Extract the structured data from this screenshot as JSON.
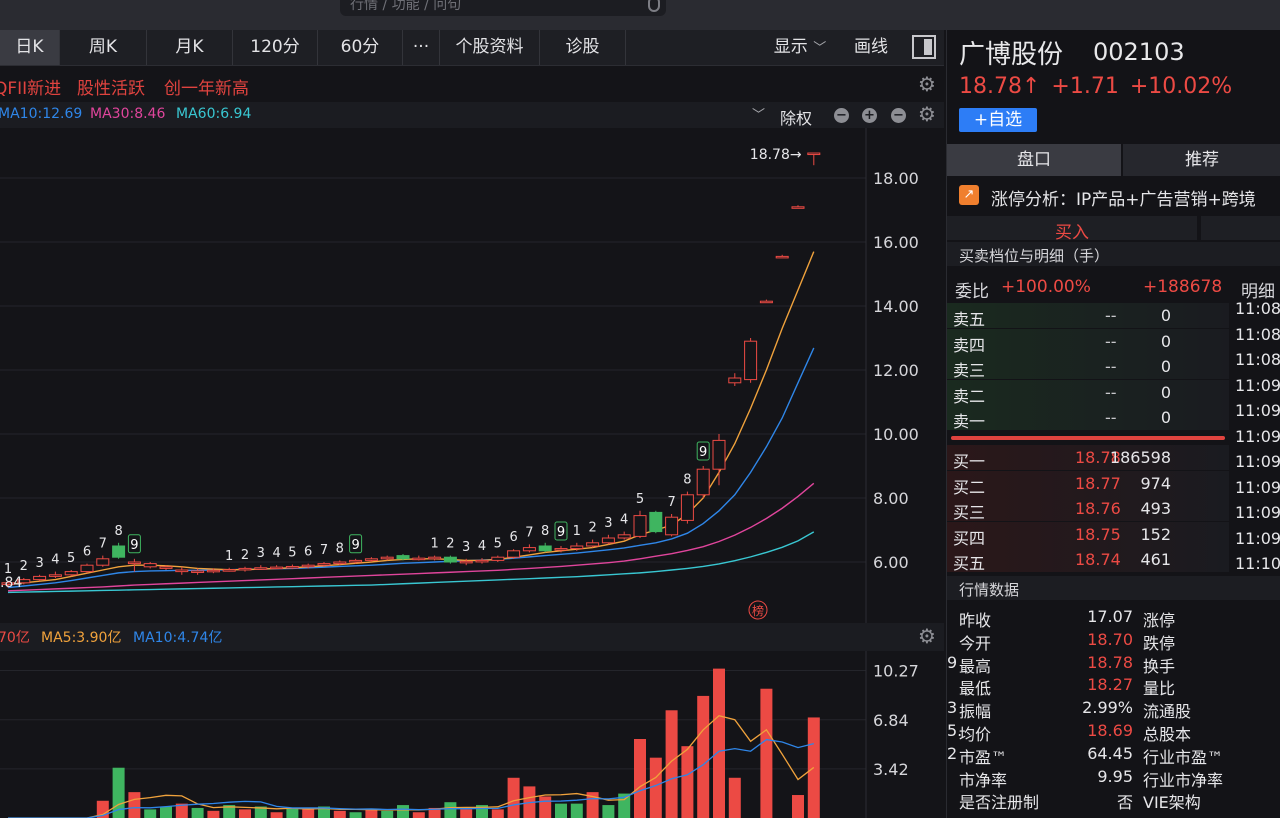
{
  "search": {
    "placeholder": "行情 / 功能 / 问句"
  },
  "toolbar": {
    "tabs": [
      "日K",
      "周K",
      "月K",
      "120分",
      "60分",
      "···",
      "个股资料",
      "诊股"
    ],
    "show": "显示",
    "draw": "画线"
  },
  "tags": [
    "QFII新进",
    "股性活跃",
    "创一年新高"
  ],
  "ma": {
    "ma10": "MA10:12.69",
    "ma30": "MA30:8.46",
    "ma60": "MA60:6.94",
    "adjust": "除权"
  },
  "vol_header": {
    "vol": "70亿",
    "ma5": "MA5:3.90亿",
    "ma10": "MA10:4.74亿"
  },
  "bang": "榜",
  "colors": {
    "up": "#ec4a44",
    "down": "#3fb560",
    "ma5": "#f0a23c",
    "ma10": "#2f86e8",
    "ma30": "#e0459c",
    "ma60": "#39c7d2",
    "bg": "#141418"
  },
  "chart_data": {
    "type": "candlestick",
    "ylim": [
      5.0,
      19.0
    ],
    "ticks": [
      "18.00",
      "16.00",
      "14.00",
      "12.00",
      "10.00",
      "8.00",
      "6.00"
    ],
    "tick_values": [
      18,
      16,
      14,
      12,
      10,
      8,
      6
    ],
    "low_label": ".84",
    "low_value": 5.84,
    "last_label": "18.78",
    "last_value": 18.78,
    "candles": [
      [
        5.3,
        5.35,
        5.2,
        5.4
      ],
      [
        5.35,
        5.45,
        5.3,
        5.5
      ],
      [
        5.45,
        5.55,
        5.4,
        5.6
      ],
      [
        5.55,
        5.6,
        5.5,
        5.7
      ],
      [
        5.6,
        5.7,
        5.55,
        5.75
      ],
      [
        5.7,
        5.9,
        5.65,
        5.95
      ],
      [
        5.9,
        6.1,
        5.85,
        6.2
      ],
      [
        6.5,
        6.15,
        6.1,
        6.6
      ],
      [
        5.95,
        6.0,
        5.7,
        6.1
      ],
      [
        5.85,
        5.95,
        5.8,
        6.0
      ],
      [
        5.8,
        5.85,
        5.75,
        5.9
      ],
      [
        5.7,
        5.75,
        5.6,
        5.85
      ],
      [
        5.7,
        5.72,
        5.6,
        5.8
      ],
      [
        5.72,
        5.74,
        5.65,
        5.8
      ],
      [
        5.74,
        5.76,
        5.7,
        5.82
      ],
      [
        5.76,
        5.8,
        5.7,
        5.85
      ],
      [
        5.8,
        5.82,
        5.75,
        5.9
      ],
      [
        5.82,
        5.84,
        5.78,
        5.9
      ],
      [
        5.84,
        5.86,
        5.78,
        5.92
      ],
      [
        5.86,
        5.9,
        5.8,
        5.95
      ],
      [
        5.9,
        5.95,
        5.85,
        6.0
      ],
      [
        5.95,
        6.0,
        5.9,
        6.05
      ],
      [
        6.0,
        6.05,
        5.95,
        6.1
      ],
      [
        6.05,
        6.1,
        6.0,
        6.15
      ],
      [
        6.1,
        6.15,
        6.05,
        6.2
      ],
      [
        6.2,
        6.1,
        6.05,
        6.25
      ],
      [
        6.1,
        6.12,
        6.05,
        6.2
      ],
      [
        6.1,
        6.15,
        6.05,
        6.2
      ],
      [
        6.15,
        6.0,
        5.95,
        6.2
      ],
      [
        6.0,
        6.02,
        5.9,
        6.1
      ],
      [
        6.02,
        6.05,
        5.95,
        6.12
      ],
      [
        6.05,
        6.15,
        6.0,
        6.2
      ],
      [
        6.15,
        6.35,
        6.1,
        6.4
      ],
      [
        6.35,
        6.45,
        6.3,
        6.55
      ],
      [
        6.5,
        6.35,
        6.3,
        6.6
      ],
      [
        6.4,
        6.42,
        6.3,
        6.5
      ],
      [
        6.42,
        6.5,
        6.35,
        6.6
      ],
      [
        6.5,
        6.6,
        6.45,
        6.7
      ],
      [
        6.6,
        6.75,
        6.55,
        6.85
      ],
      [
        6.75,
        6.85,
        6.7,
        6.95
      ],
      [
        6.8,
        7.45,
        6.75,
        7.6
      ],
      [
        7.55,
        6.95,
        6.9,
        7.6
      ],
      [
        6.85,
        7.4,
        6.8,
        7.5
      ],
      [
        7.3,
        8.1,
        7.2,
        8.2
      ],
      [
        8.1,
        8.9,
        8.0,
        9.0
      ],
      [
        8.9,
        9.8,
        8.4,
        10.0
      ],
      [
        11.6,
        11.75,
        11.5,
        11.9
      ],
      [
        11.7,
        12.9,
        11.6,
        13.0
      ],
      [
        14.15,
        14.15,
        14.15,
        14.2
      ],
      [
        15.55,
        15.55,
        15.55,
        15.6
      ],
      [
        17.1,
        17.1,
        17.1,
        17.15
      ],
      [
        18.78,
        18.78,
        18.4,
        18.78
      ]
    ],
    "counts": [
      "1",
      "2",
      "3",
      "4",
      "5",
      "6",
      "7",
      "8",
      "9",
      "",
      "",
      "",
      "",
      "",
      "1",
      "2",
      "3",
      "4",
      "5",
      "6",
      "7",
      "8",
      "9",
      "",
      "",
      "",
      "",
      "1",
      "2",
      "3",
      "4",
      "5",
      "6",
      "7",
      "8",
      "9",
      "1",
      "2",
      "3",
      "4",
      "5",
      "",
      "7",
      "8",
      "9",
      "",
      "",
      "",
      "",
      "",
      "",
      ""
    ],
    "ma10_line": [
      5.2,
      5.25,
      5.3,
      5.35,
      5.42,
      5.5,
      5.58,
      5.66,
      5.7,
      5.72,
      5.73,
      5.74,
      5.74,
      5.75,
      5.76,
      5.77,
      5.78,
      5.79,
      5.8,
      5.82,
      5.84,
      5.86,
      5.88,
      5.9,
      5.93,
      5.96,
      5.98,
      6.0,
      6.02,
      6.04,
      6.06,
      6.08,
      6.12,
      6.16,
      6.2,
      6.24,
      6.28,
      6.33,
      6.38,
      6.44,
      6.52,
      6.6,
      6.72,
      6.9,
      7.2,
      7.6,
      8.1,
      8.8,
      9.6,
      10.5,
      11.6,
      12.69
    ],
    "ma5_line": [
      5.3,
      5.35,
      5.4,
      5.45,
      5.55,
      5.65,
      5.75,
      5.85,
      5.9,
      5.9,
      5.88,
      5.85,
      5.8,
      5.78,
      5.76,
      5.76,
      5.78,
      5.8,
      5.82,
      5.85,
      5.88,
      5.92,
      5.96,
      6.0,
      6.05,
      6.08,
      6.1,
      6.1,
      6.08,
      6.05,
      6.05,
      6.08,
      6.15,
      6.22,
      6.3,
      6.35,
      6.4,
      6.45,
      6.55,
      6.65,
      6.85,
      7.0,
      7.15,
      7.5,
      8.0,
      8.8,
      9.7,
      10.8,
      12.0,
      13.3,
      14.5,
      15.7
    ],
    "ma30_line": [
      5.1,
      5.12,
      5.14,
      5.16,
      5.18,
      5.2,
      5.22,
      5.25,
      5.28,
      5.3,
      5.32,
      5.34,
      5.36,
      5.38,
      5.4,
      5.42,
      5.44,
      5.46,
      5.48,
      5.5,
      5.52,
      5.54,
      5.56,
      5.58,
      5.6,
      5.62,
      5.64,
      5.66,
      5.68,
      5.7,
      5.72,
      5.74,
      5.77,
      5.8,
      5.83,
      5.86,
      5.9,
      5.94,
      5.98,
      6.03,
      6.1,
      6.18,
      6.26,
      6.36,
      6.48,
      6.64,
      6.84,
      7.08,
      7.36,
      7.68,
      8.05,
      8.46
    ],
    "ma60_line": [
      5.05,
      5.06,
      5.07,
      5.08,
      5.09,
      5.1,
      5.11,
      5.12,
      5.13,
      5.14,
      5.15,
      5.16,
      5.17,
      5.18,
      5.19,
      5.2,
      5.21,
      5.22,
      5.23,
      5.24,
      5.25,
      5.26,
      5.27,
      5.28,
      5.3,
      5.32,
      5.34,
      5.36,
      5.38,
      5.4,
      5.42,
      5.44,
      5.46,
      5.48,
      5.5,
      5.52,
      5.54,
      5.57,
      5.6,
      5.63,
      5.66,
      5.7,
      5.75,
      5.8,
      5.86,
      5.94,
      6.04,
      6.16,
      6.3,
      6.46,
      6.66,
      6.94
    ],
    "vol_ticks": [
      "10.27",
      "6.84",
      "3.42"
    ],
    "vol_tick_values": [
      10.27,
      6.84,
      3.42
    ],
    "vol_max": 11.0,
    "volumes": [
      [
        0,
        0
      ],
      [
        0,
        0
      ],
      [
        0,
        0
      ],
      [
        0,
        0
      ],
      [
        0,
        0
      ],
      [
        0,
        0
      ],
      [
        1.2,
        1
      ],
      [
        3.5,
        0
      ],
      [
        1.8,
        1
      ],
      [
        0.6,
        0
      ],
      [
        0.8,
        0
      ],
      [
        1.0,
        1
      ],
      [
        0.7,
        0
      ],
      [
        0.5,
        1
      ],
      [
        0.9,
        0
      ],
      [
        0.6,
        1
      ],
      [
        0.8,
        0
      ],
      [
        0.4,
        1
      ],
      [
        0.7,
        0
      ],
      [
        0.6,
        1
      ],
      [
        0.8,
        0
      ],
      [
        0.5,
        1
      ],
      [
        0.4,
        0
      ],
      [
        0.6,
        1
      ],
      [
        0.5,
        0
      ],
      [
        0.9,
        0
      ],
      [
        0.4,
        1
      ],
      [
        0.7,
        1
      ],
      [
        1.1,
        0
      ],
      [
        0.6,
        1
      ],
      [
        0.9,
        0
      ],
      [
        0.6,
        1
      ],
      [
        2.8,
        1
      ],
      [
        2.2,
        1
      ],
      [
        1.5,
        1
      ],
      [
        1.0,
        0
      ],
      [
        1.0,
        0
      ],
      [
        1.8,
        1
      ],
      [
        0.9,
        0
      ],
      [
        1.7,
        0
      ],
      [
        5.5,
        1
      ],
      [
        4.2,
        1
      ],
      [
        7.5,
        1
      ],
      [
        5.0,
        1
      ],
      [
        8.5,
        1
      ],
      [
        10.4,
        1
      ],
      [
        2.8,
        1
      ],
      [
        0,
        0
      ],
      [
        9.0,
        1
      ],
      [
        0,
        0
      ],
      [
        1.6,
        1
      ],
      [
        7.0,
        1
      ]
    ]
  },
  "stock": {
    "name": "广博股份",
    "code": "002103",
    "price": "18.78↑",
    "change": "+1.71",
    "pct": "+10.02%",
    "fav": "+自选"
  },
  "tabs": [
    "盘口",
    "推荐"
  ],
  "zt": {
    "icon": "↗",
    "text": "涨停分析：IP产品+广告营销+跨境"
  },
  "buy_label": "买入",
  "order_header": "买卖档位与明细（手）",
  "weibi": {
    "label": "委比",
    "pct": "+100.00%",
    "diff": "+188678",
    "mx": "明细"
  },
  "sells": [
    [
      "卖五",
      "--",
      "0"
    ],
    [
      "卖四",
      "--",
      "0"
    ],
    [
      "卖三",
      "--",
      "0"
    ],
    [
      "卖二",
      "--",
      "0"
    ],
    [
      "卖一",
      "--",
      "0"
    ]
  ],
  "buys": [
    [
      "买一",
      "18.78",
      "186598"
    ],
    [
      "买二",
      "18.77",
      "974"
    ],
    [
      "买三",
      "18.76",
      "493"
    ],
    [
      "买四",
      "18.75",
      "152"
    ],
    [
      "买五",
      "18.74",
      "461"
    ]
  ],
  "times": [
    "11:08",
    "11:08",
    "11:08",
    "11:09",
    "11:09",
    "11:09",
    "11:09",
    "11:09",
    "11:09",
    "11:09",
    "11:10",
    "11:10"
  ],
  "hq_title": "行情数据",
  "hq": [
    [
      "昨收",
      "17.07",
      "white",
      "涨停",
      ""
    ],
    [
      "今开",
      "18.70",
      "red",
      "跌停",
      ""
    ],
    [
      "最高",
      "18.78",
      "red",
      "换手",
      "9"
    ],
    [
      "最低",
      "18.27",
      "red",
      "量比",
      ""
    ],
    [
      "振幅",
      "2.99%",
      "white",
      "流通股",
      "3"
    ],
    [
      "均价",
      "18.69",
      "red",
      "总股本",
      "5."
    ],
    [
      "市盈™",
      "64.45",
      "white",
      "行业市盈™",
      "2"
    ],
    [
      "市净率",
      "9.95",
      "white",
      "行业市净率",
      ""
    ],
    [
      "是否注册制",
      "否",
      "white",
      "VIE架构",
      ""
    ]
  ]
}
